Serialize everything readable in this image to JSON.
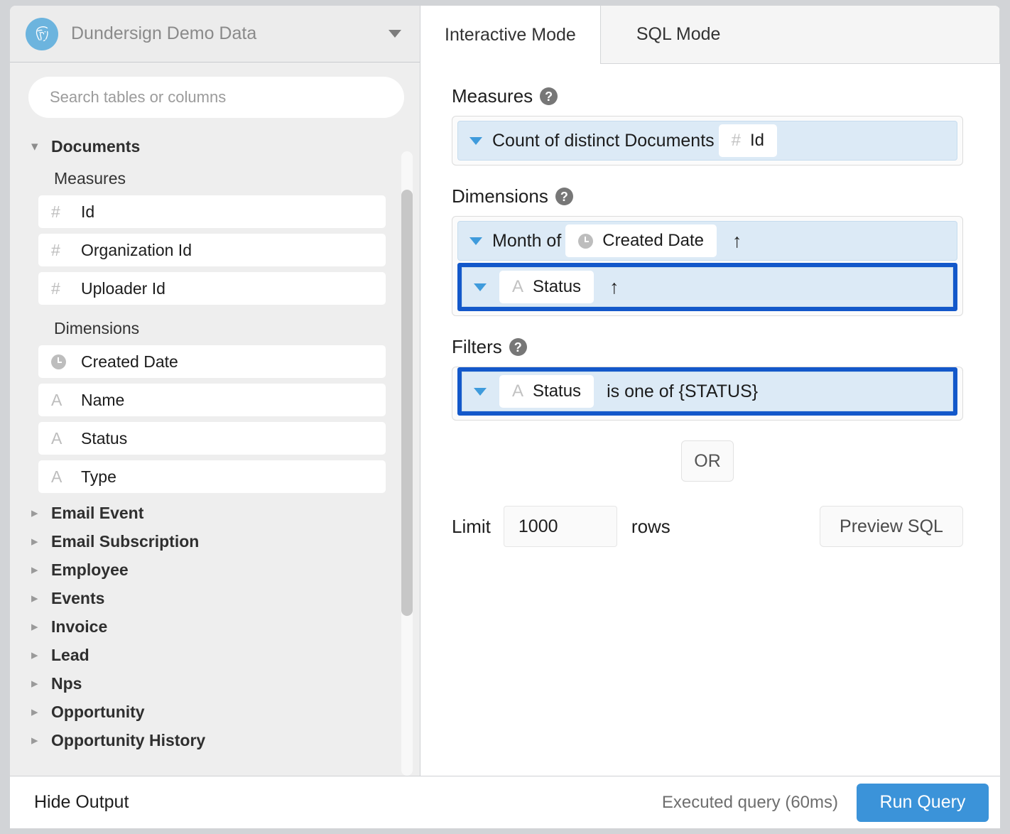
{
  "database": {
    "name": "Dundersign Demo Data",
    "logo_icon": "postgresql-elephant-icon",
    "caret_icon": "chevron-down-icon"
  },
  "search": {
    "placeholder": "Search tables or columns",
    "value": ""
  },
  "sidebar": {
    "expanded_table": {
      "name": "Documents",
      "chevron_icon": "chevron-down-icon",
      "groups": [
        {
          "label": "Measures",
          "fields": [
            {
              "icon": "hash-icon",
              "icon_glyph": "#",
              "name": "Id"
            },
            {
              "icon": "hash-icon",
              "icon_glyph": "#",
              "name": "Organization Id"
            },
            {
              "icon": "hash-icon",
              "icon_glyph": "#",
              "name": "Uploader Id"
            }
          ]
        },
        {
          "label": "Dimensions",
          "fields": [
            {
              "icon": "clock-icon",
              "icon_glyph": "",
              "name": "Created Date"
            },
            {
              "icon": "text-icon",
              "icon_glyph": "A",
              "name": "Name"
            },
            {
              "icon": "text-icon",
              "icon_glyph": "A",
              "name": "Status"
            },
            {
              "icon": "text-icon",
              "icon_glyph": "A",
              "name": "Type"
            }
          ]
        }
      ]
    },
    "collapsed_tables": [
      {
        "chevron_icon": "chevron-right-icon",
        "name": "Email Event"
      },
      {
        "chevron_icon": "chevron-right-icon",
        "name": "Email Subscription"
      },
      {
        "chevron_icon": "chevron-right-icon",
        "name": "Employee"
      },
      {
        "chevron_icon": "chevron-right-icon",
        "name": "Events"
      },
      {
        "chevron_icon": "chevron-right-icon",
        "name": "Invoice"
      },
      {
        "chevron_icon": "chevron-right-icon",
        "name": "Lead"
      },
      {
        "chevron_icon": "chevron-right-icon",
        "name": "Nps"
      },
      {
        "chevron_icon": "chevron-right-icon",
        "name": "Opportunity"
      },
      {
        "chevron_icon": "chevron-right-icon",
        "name": "Opportunity History"
      }
    ]
  },
  "tabs": [
    {
      "label": "Interactive Mode",
      "active": true
    },
    {
      "label": "SQL Mode",
      "active": false
    }
  ],
  "query_builder": {
    "measures": {
      "title": "Measures",
      "help_icon": "help-icon",
      "help_glyph": "?",
      "rows": [
        {
          "caret_icon": "caret-down-icon",
          "aggregation": "Count of distinct Documents",
          "chip_icon": "hash-icon",
          "chip_icon_glyph": "#",
          "chip_label": "Id",
          "highlighted": false
        }
      ]
    },
    "dimensions": {
      "title": "Dimensions",
      "help_icon": "help-icon",
      "help_glyph": "?",
      "rows": [
        {
          "caret_icon": "caret-down-icon",
          "prefix": "Month of",
          "chip_icon": "clock-icon",
          "chip_icon_glyph": "",
          "chip_label": "Created Date",
          "sort_icon": "sort-ascending-icon",
          "sort_glyph": "↑",
          "highlighted": false
        },
        {
          "caret_icon": "caret-down-icon",
          "prefix": "",
          "chip_icon": "text-icon",
          "chip_icon_glyph": "A",
          "chip_label": "Status",
          "sort_icon": "sort-ascending-icon",
          "sort_glyph": "↑",
          "highlighted": true
        }
      ]
    },
    "filters": {
      "title": "Filters",
      "help_icon": "help-icon",
      "help_glyph": "?",
      "rows": [
        {
          "caret_icon": "caret-down-icon",
          "chip_icon": "text-icon",
          "chip_icon_glyph": "A",
          "chip_label": "Status",
          "expression": "is one of {STATUS}",
          "highlighted": true
        }
      ]
    },
    "or_button": "OR",
    "limit": {
      "label": "Limit",
      "value": "1000",
      "unit": "rows"
    },
    "preview_sql_button": "Preview SQL"
  },
  "footer": {
    "hide_output": "Hide Output",
    "status": "Executed query (60ms)",
    "run_button": "Run Query"
  },
  "colors": {
    "accent_blue": "#3b93d9",
    "selection_blue": "#1358ca",
    "pill_blue": "#dceaf6",
    "logo_blue": "#6cb4de"
  }
}
